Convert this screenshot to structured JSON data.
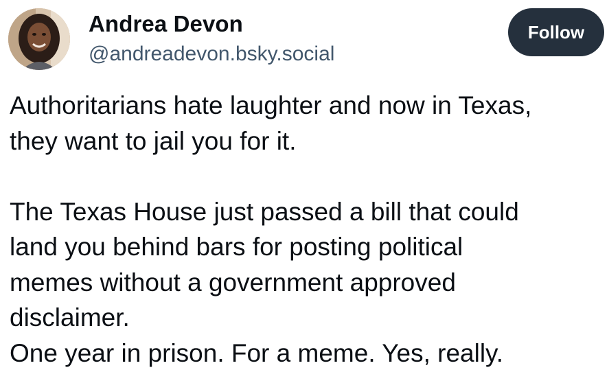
{
  "author": {
    "display_name": "Andrea Devon",
    "handle": "@andreadevon.bsky.social"
  },
  "follow_label": "Follow",
  "post": {
    "paragraph_1": [
      "Authoritarians hate laughter and now in Texas,",
      "they want to jail you for it."
    ],
    "paragraph_2": [
      "The Texas House just passed a bill that could",
      "land you behind bars for posting political",
      "memes without a government approved",
      "disclaimer.",
      "One year in prison. For a meme. Yes, really."
    ]
  },
  "colors": {
    "follow_bg": "#25303d",
    "handle": "#42576c",
    "text": "#0b0f14"
  },
  "icons": {
    "avatar": "profile-photo"
  }
}
